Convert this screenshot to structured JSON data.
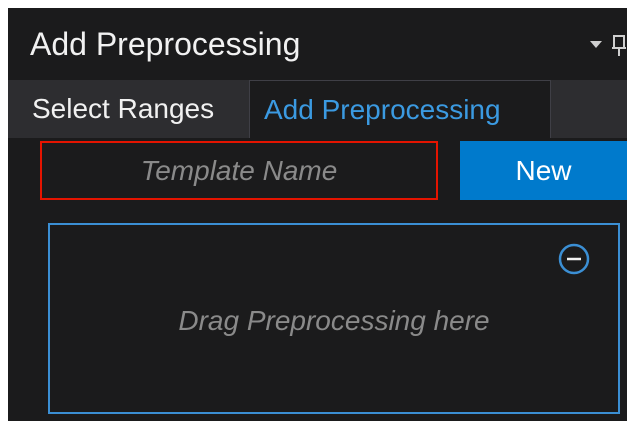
{
  "window": {
    "title": "Add Preprocessing"
  },
  "tabs": [
    {
      "label": "Select Ranges",
      "active": false
    },
    {
      "label": "Add Preprocessing",
      "active": true
    }
  ],
  "form": {
    "template_name_placeholder": "Template Name",
    "template_name_value": "",
    "new_button_label": "New"
  },
  "dropzone": {
    "hint": "Drag Preprocessing here"
  },
  "icons": {
    "dropdown": "chevron-down-icon",
    "pin": "pin-icon",
    "remove": "minus-circle-icon"
  },
  "colors": {
    "background": "#1b1b1c",
    "tabstrip": "#2d2d30",
    "accent": "#007acc",
    "active_tab_text": "#3b9ae1",
    "input_border": "#e51400",
    "dropzone_border": "#3b8fd4"
  }
}
